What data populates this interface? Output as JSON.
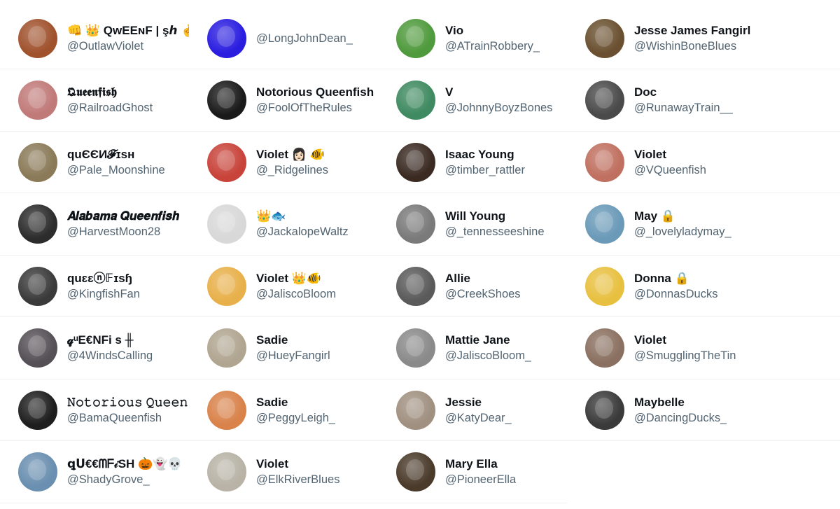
{
  "columns": [
    [
      {
        "name": "👊 👑 QᴡEEɴF | şℎ 🤞",
        "handle": "@OutlawViolet",
        "avatar_color": "#a0522d"
      },
      {
        "name": "𝕼𝖚𝖊𝖊𝖓𝖋𝖎𝖘𝖍",
        "handle": "@RailroadGhost",
        "avatar_color": "#c07a78"
      },
      {
        "name": "quЄЄИ𝓕ɪsʜ",
        "handle": "@Pale_Moonshine",
        "avatar_color": "#8a7a58"
      },
      {
        "name": "𝑨𝒍𝒂𝒃𝒂𝒎𝒂 𝑸𝒖𝒆𝒆𝒏𝒇𝒊𝒔𝒉",
        "handle": "@HarvestMoon28",
        "avatar_color": "#2c2c2c"
      },
      {
        "name": "quɛɛⓝ𝔽ɪsɧ",
        "handle": "@KingfishFan",
        "avatar_color": "#3a3a3a"
      },
      {
        "name": "𝓺ᵘE€NFi s ╫",
        "handle": "@4WindsCalling",
        "avatar_color": "#555055"
      },
      {
        "name": "𝙽𝚘𝚝𝚘𝚛𝚒𝚘𝚞𝚜 𝚀𝚞𝚎𝚎𝚗𝚏𝚒𝚜𝚑",
        "handle": "@BamaQueenfish",
        "avatar_color": "#1e1e1e"
      },
      {
        "name": "ꝗᑌ€€ᗰᖴ𝒾SH 🎃👻💀",
        "handle": "@ShadyGrove_",
        "avatar_color": "#6a8fb0"
      }
    ],
    [
      {
        "name": "",
        "handle": "@LongJohnDean_",
        "avatar_color": "#2a1de0"
      },
      {
        "name": "Notorious Queenfish",
        "handle": "@FoolOfTheRules",
        "avatar_color": "#1a1a1a"
      },
      {
        "name": "Violet 👩🏻 🐠",
        "handle": "@_Ridgelines",
        "avatar_color": "#c8433a"
      },
      {
        "name": "👑🐟",
        "handle": "@JackalopeWaltz",
        "avatar_color": "#d8d8d8"
      },
      {
        "name": "Violet 👑🐠",
        "handle": "@JaliscoBloom",
        "avatar_color": "#e8b04a"
      },
      {
        "name": "Sadie",
        "handle": "@HueyFangirl",
        "avatar_color": "#b0a590"
      },
      {
        "name": "Sadie",
        "handle": "@PeggyLeigh_",
        "avatar_color": "#d9824a"
      },
      {
        "name": "Violet",
        "handle": "@ElkRiverBlues",
        "avatar_color": "#b8b3a6"
      }
    ],
    [
      {
        "name": "Vio",
        "handle": "@ATrainRobbery_",
        "avatar_color": "#4f9a3c"
      },
      {
        "name": "V",
        "handle": "@JohnnyBoyzBones",
        "avatar_color": "#3f8a60"
      },
      {
        "name": "Isaac Young",
        "handle": "@timber_rattler",
        "avatar_color": "#3a2a22"
      },
      {
        "name": "Will Young",
        "handle": "@_tennesseeshine",
        "avatar_color": "#7a7a7a"
      },
      {
        "name": "Allie",
        "handle": "@CreekShoes",
        "avatar_color": "#5a5a5a"
      },
      {
        "name": "Mattie Jane",
        "handle": "@JaliscoBloom_",
        "avatar_color": "#8a8a8a"
      },
      {
        "name": "Jessie",
        "handle": "@KatyDear_",
        "avatar_color": "#a09080"
      },
      {
        "name": "Mary Ella",
        "handle": "@PioneerElla",
        "avatar_color": "#4a3a2a"
      }
    ],
    [
      {
        "name": "Jesse James Fangirl",
        "handle": "@WishinBoneBlues",
        "avatar_color": "#6a5030"
      },
      {
        "name": "Doc",
        "handle": "@RunawayTrain__",
        "avatar_color": "#4a4a4a"
      },
      {
        "name": "Violet",
        "handle": "@VQueenfish",
        "avatar_color": "#c07060"
      },
      {
        "name": "May 🔒",
        "handle": "@_lovelyladymay_",
        "avatar_color": "#6a9ab8"
      },
      {
        "name": "Donna 🔒",
        "handle": "@DonnasDucks",
        "avatar_color": "#e8c040"
      },
      {
        "name": "Violet",
        "handle": "@SmugglingTheTin",
        "avatar_color": "#8a7060"
      },
      {
        "name": "Maybelle",
        "handle": "@DancingDucks_",
        "avatar_color": "#3a3a3a"
      }
    ]
  ]
}
